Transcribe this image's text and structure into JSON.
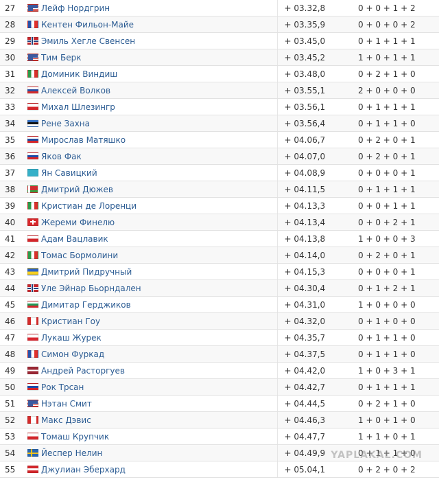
{
  "rows": [
    {
      "pos": "27",
      "country": "usa",
      "name": "Лейф Нордгрин",
      "gap": "+ 03.32,8",
      "shots": "0 + 0 + 1 + 2"
    },
    {
      "pos": "28",
      "country": "fra",
      "name": "Кентен Фильон-Майе",
      "gap": "+ 03.35,9",
      "shots": "0 + 0 + 0 + 2"
    },
    {
      "pos": "29",
      "country": "nor",
      "name": "Эмиль Хегле Свенсен",
      "gap": "+ 03.45,0",
      "shots": "0 + 1 + 1 + 1"
    },
    {
      "pos": "30",
      "country": "usa",
      "name": "Тим Берк",
      "gap": "+ 03.45,2",
      "shots": "1 + 0 + 1 + 1"
    },
    {
      "pos": "31",
      "country": "ita",
      "name": "Доминик Виндиш",
      "gap": "+ 03.48,0",
      "shots": "0 + 2 + 1 + 0"
    },
    {
      "pos": "32",
      "country": "rus",
      "name": "Алексей Волков",
      "gap": "+ 03.55,1",
      "shots": "2 + 0 + 0 + 0"
    },
    {
      "pos": "33",
      "country": "cze",
      "name": "Михал Шлезингр",
      "gap": "+ 03.56,1",
      "shots": "0 + 1 + 1 + 1"
    },
    {
      "pos": "34",
      "country": "est",
      "name": "Рене Захна",
      "gap": "+ 03.56,4",
      "shots": "0 + 1 + 1 + 0"
    },
    {
      "pos": "35",
      "country": "svk",
      "name": "Мирослав Матяшко",
      "gap": "+ 04.06,7",
      "shots": "0 + 2 + 0 + 1"
    },
    {
      "pos": "36",
      "country": "slo",
      "name": "Яков Фак",
      "gap": "+ 04.07,0",
      "shots": "0 + 2 + 0 + 1"
    },
    {
      "pos": "37",
      "country": "kaz",
      "name": "Ян Савицкий",
      "gap": "+ 04.08,9",
      "shots": "0 + 0 + 0 + 1"
    },
    {
      "pos": "38",
      "country": "blr",
      "name": "Дмитрий Дюжев",
      "gap": "+ 04.11,5",
      "shots": "0 + 1 + 1 + 1"
    },
    {
      "pos": "39",
      "country": "ita",
      "name": "Кристиан де Лоренци",
      "gap": "+ 04.13,3",
      "shots": "0 + 0 + 1 + 1"
    },
    {
      "pos": "40",
      "country": "sui",
      "name": "Жереми Финелю",
      "gap": "+ 04.13,4",
      "shots": "0 + 0 + 2 + 1"
    },
    {
      "pos": "41",
      "country": "cze",
      "name": "Адам Вацлавик",
      "gap": "+ 04.13,8",
      "shots": "1 + 0 + 0 + 3"
    },
    {
      "pos": "42",
      "country": "ita",
      "name": "Томас Бормолини",
      "gap": "+ 04.14,0",
      "shots": "0 + 2 + 0 + 1"
    },
    {
      "pos": "43",
      "country": "ukr",
      "name": "Дмитрий Пидручный",
      "gap": "+ 04.15,3",
      "shots": "0 + 0 + 0 + 1"
    },
    {
      "pos": "44",
      "country": "nor",
      "name": "Уле Эйнар Бьорндален",
      "gap": "+ 04.30,4",
      "shots": "0 + 1 + 2 + 1"
    },
    {
      "pos": "45",
      "country": "bul",
      "name": "Димитар Герджиков",
      "gap": "+ 04.31,0",
      "shots": "1 + 0 + 0 + 0"
    },
    {
      "pos": "46",
      "country": "can",
      "name": "Кристиан Гоу",
      "gap": "+ 04.32,0",
      "shots": "0 + 1 + 0 + 0"
    },
    {
      "pos": "47",
      "country": "pol",
      "name": "Лукаш Журек",
      "gap": "+ 04.35,7",
      "shots": "0 + 1 + 1 + 0"
    },
    {
      "pos": "48",
      "country": "fra",
      "name": "Симон Фуркад",
      "gap": "+ 04.37,5",
      "shots": "0 + 1 + 1 + 0"
    },
    {
      "pos": "49",
      "country": "lat",
      "name": "Андрей Расторгуев",
      "gap": "+ 04.42,0",
      "shots": "1 + 0 + 3 + 1"
    },
    {
      "pos": "50",
      "country": "slo",
      "name": "Рок Трсан",
      "gap": "+ 04.42,7",
      "shots": "0 + 1 + 1 + 1"
    },
    {
      "pos": "51",
      "country": "usa",
      "name": "Нэтан Смит",
      "gap": "+ 04.44,5",
      "shots": "0 + 2 + 1 + 0"
    },
    {
      "pos": "52",
      "country": "can",
      "name": "Макс Дэвис",
      "gap": "+ 04.46,3",
      "shots": "1 + 0 + 1 + 0"
    },
    {
      "pos": "53",
      "country": "cze",
      "name": "Томаш Крупчик",
      "gap": "+ 04.47,7",
      "shots": "1 + 1 + 0 + 1"
    },
    {
      "pos": "54",
      "country": "swe",
      "name": "Йеспер Нелин",
      "gap": "+ 04.49,9",
      "shots": "0 + 1 + 1 + 0"
    },
    {
      "pos": "55",
      "country": "aut",
      "name": "Джулиан Эберхард",
      "gap": "+ 05.04,1",
      "shots": "0 + 2 + 0 + 2"
    }
  ],
  "watermark": "YAPLAKAL.COM"
}
